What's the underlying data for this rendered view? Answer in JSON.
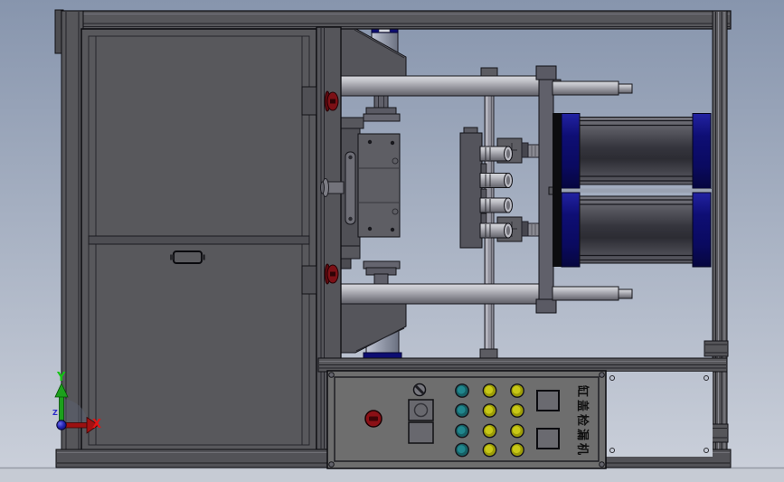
{
  "colors": {
    "bg-top": "#8795ad",
    "bg-bottom": "#ccd1db",
    "floor": "#c6cbd4",
    "frame": "#57575b",
    "door": "#58585c",
    "panel": "#6e6e6e",
    "cap-blue": "#0d0d72",
    "estop": "#8b1016",
    "knob-red": "#7c1016",
    "label": "#101010"
  },
  "machine": {
    "label": "缸盖检漏机"
  },
  "triad": {
    "x_label": "X",
    "y_label": "Y",
    "z_label": "Z"
  },
  "control_panel": {
    "indicators": {
      "rows": 4,
      "column_colors": [
        "teal",
        "yellow",
        "yellow"
      ],
      "palette": {
        "teal": {
          "outer": "#156065",
          "inner": "#20868d"
        },
        "yellow": {
          "outer": "#9c9c08",
          "inner": "#c8c816"
        }
      }
    }
  }
}
